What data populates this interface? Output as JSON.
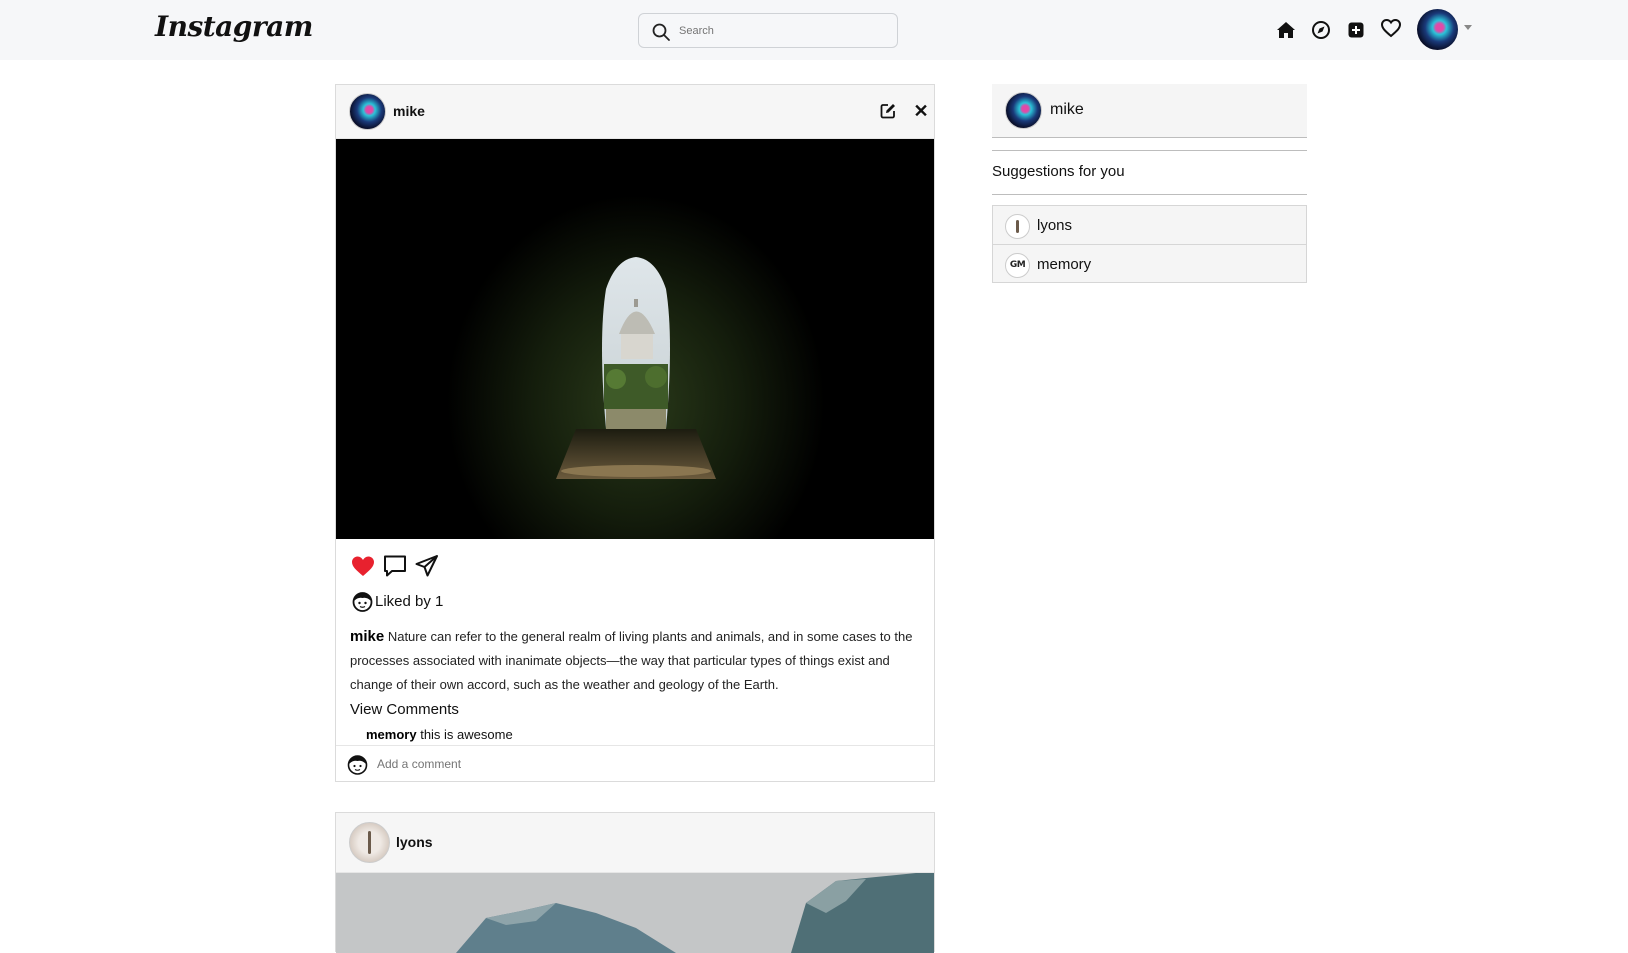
{
  "app": {
    "logo_text": "Instagram"
  },
  "search": {
    "placeholder": "Search"
  },
  "nav": {
    "icons": [
      "home-icon",
      "explore-icon",
      "new-post-icon",
      "activity-heart-icon"
    ],
    "profile_menu": "caret-down-icon"
  },
  "posts": [
    {
      "username": "mike",
      "liked_by": "Liked by 1",
      "caption_user": "mike",
      "caption_text": "Nature can refer to the general realm of living plants and animals, and in some cases to the processes associated with inanimate objects—the way that particular types of things exist and change of their own accord, such as the weather and geology of the Earth.",
      "view_comments": "View Comments",
      "comments": [
        {
          "user": "memory",
          "text": "this is awesome"
        }
      ],
      "add_comment_placeholder": "Add a comment",
      "liked": true
    },
    {
      "username": "lyons"
    }
  ],
  "sidebar": {
    "current_user": "mike",
    "suggestions_title": "Suggestions for you",
    "suggestions": [
      {
        "username": "lyons"
      },
      {
        "username": "memory",
        "avatar_text": "GM"
      }
    ]
  },
  "colors": {
    "topbar_bg": "#f6f7f9",
    "like_red": "#e8212e"
  }
}
